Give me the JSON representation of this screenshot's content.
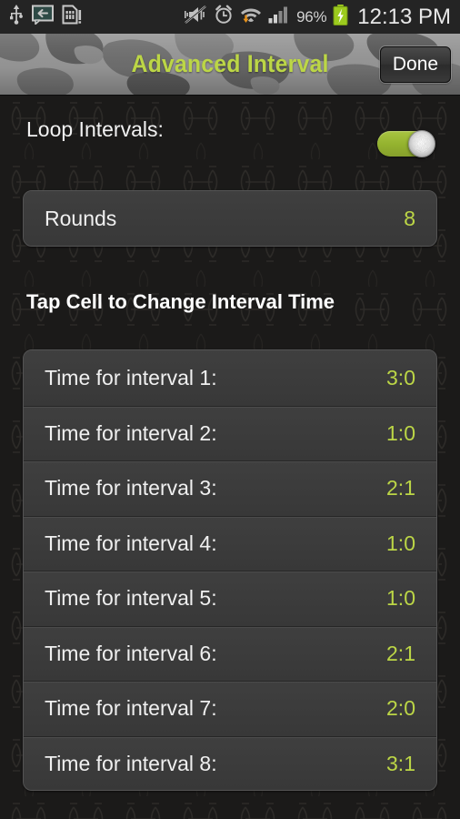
{
  "statusbar": {
    "icons_left": [
      "usb-icon",
      "sms-reply-icon",
      "sim-card-icon"
    ],
    "icons_right": [
      "mute-vibrate-off-icon",
      "alarm-clock-icon",
      "wifi-download-icon",
      "signal-bars-icon"
    ],
    "battery_percent": "96%",
    "battery_icon": "battery-charging-icon",
    "clock": "12:13 PM"
  },
  "titlebar": {
    "title": "Advanced Interval",
    "done_label": "Done",
    "title_color": "#bcd646"
  },
  "loop": {
    "label": "Loop Intervals:",
    "toggle_state": "on",
    "toggle_color": "#93b22e"
  },
  "rounds": {
    "label": "Rounds",
    "value": "8"
  },
  "section": {
    "heading": "Tap Cell to Change Interval Time"
  },
  "intervals": [
    {
      "label": "Time for interval 1:",
      "value": "3:0"
    },
    {
      "label": "Time for interval 2:",
      "value": "1:0"
    },
    {
      "label": "Time for interval 3:",
      "value": "2:1"
    },
    {
      "label": "Time for interval 4:",
      "value": "1:0"
    },
    {
      "label": "Time for interval 5:",
      "value": "1:0"
    },
    {
      "label": "Time for interval 6:",
      "value": "2:1"
    },
    {
      "label": "Time for interval 7:",
      "value": "2:0"
    },
    {
      "label": "Time for interval 8:",
      "value": "3:1"
    }
  ],
  "colors": {
    "accent": "#bcd646",
    "cell_bg": "#3b3b3b",
    "page_bg": "#1b1a19"
  }
}
